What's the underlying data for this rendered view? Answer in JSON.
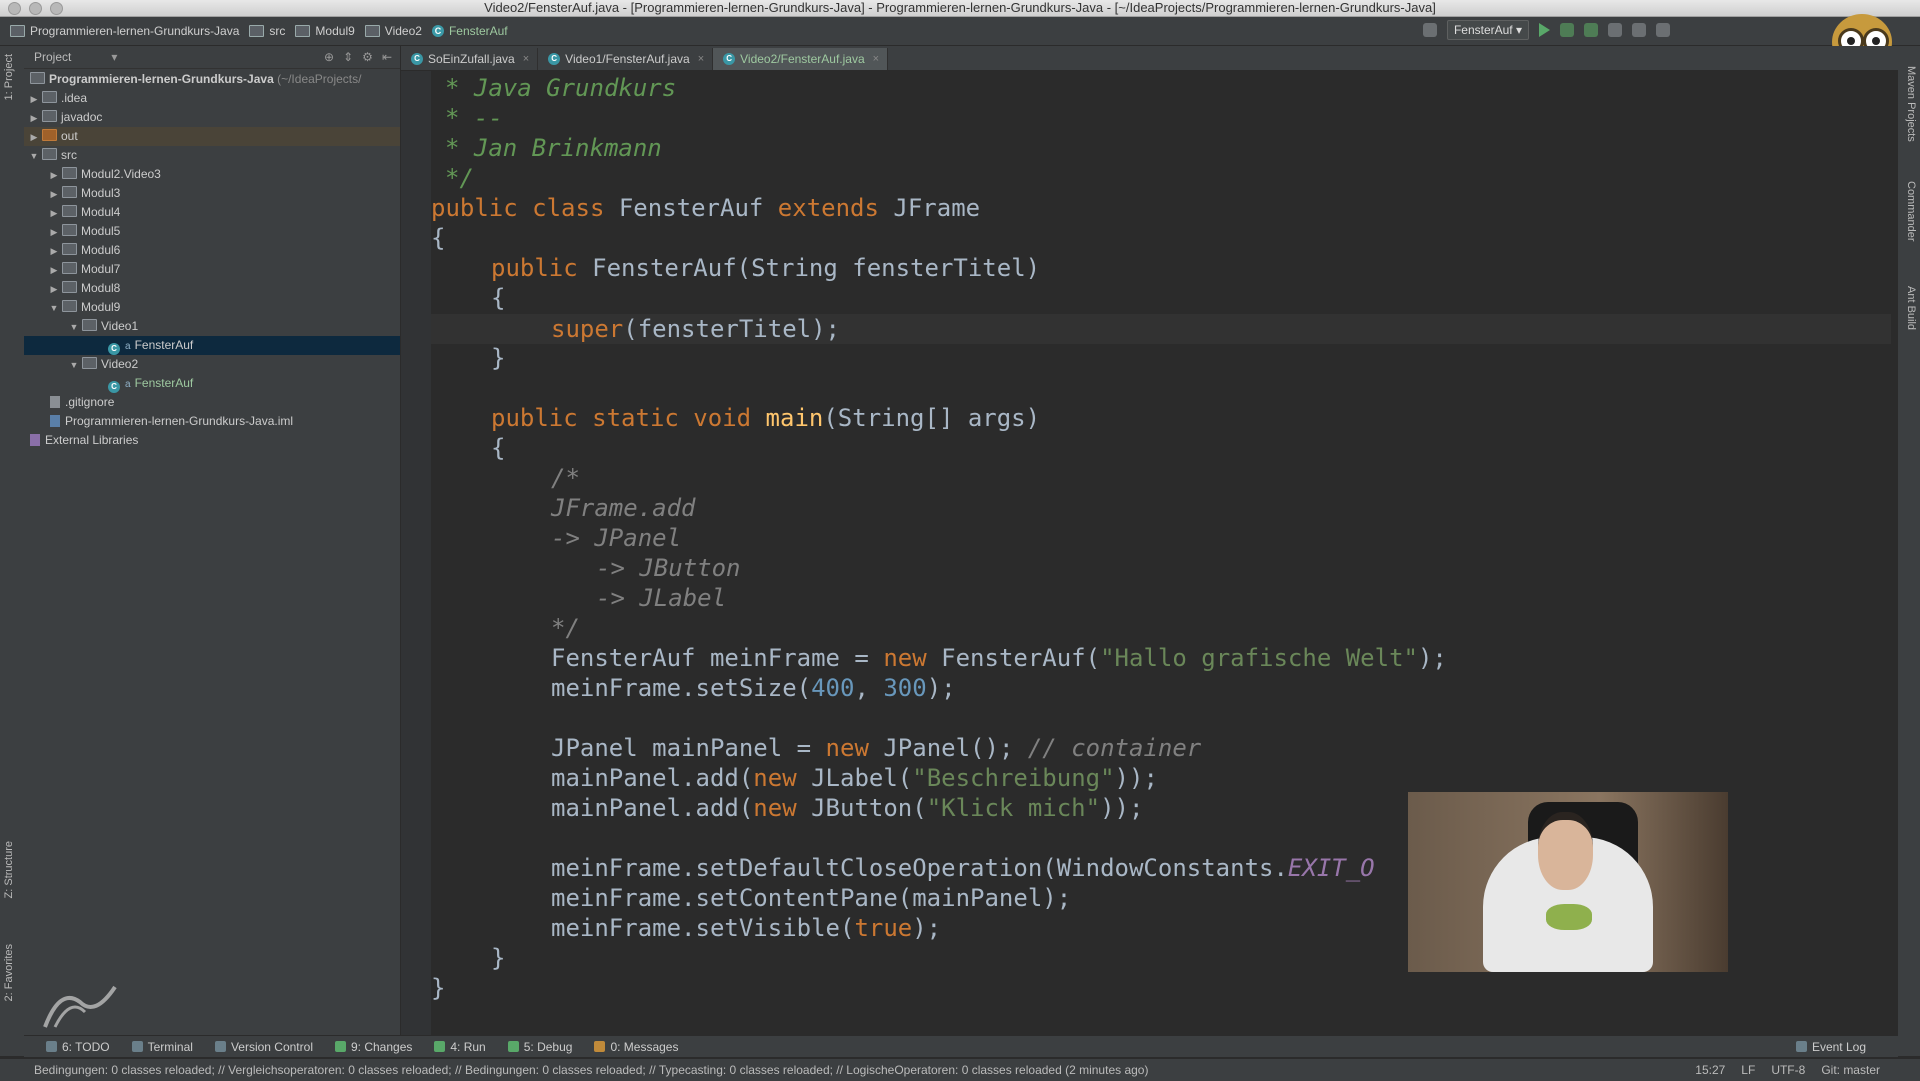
{
  "window": {
    "title": "Video2/FensterAuf.java - [Programmieren-lernen-Grundkurs-Java] - Programmieren-lernen-Grundkurs-Java - [~/IdeaProjects/Programmieren-lernen-Grundkurs-Java]"
  },
  "navbar": {
    "crumbs": [
      "Programmieren-lernen-Grundkurs-Java",
      "src",
      "Modul9",
      "Video2",
      "FensterAuf"
    ],
    "run_config": "FensterAuf"
  },
  "left_strip": {
    "tab1": "1: Project",
    "tab2": "Z: Structure",
    "tab3": "2: Favorites"
  },
  "right_strip": {
    "tab1": "Maven Projects",
    "tab2": "Commander",
    "tab3": "Ant Build"
  },
  "project_panel": {
    "header": "Project",
    "root": "Programmieren-lernen-Grundkurs-Java",
    "root_path": "(~/IdeaProjects/",
    "items": [
      {
        "label": ".idea"
      },
      {
        "label": "javadoc"
      },
      {
        "label": "out"
      },
      {
        "label": "src"
      },
      {
        "label": "Modul2.Video3"
      },
      {
        "label": "Modul3"
      },
      {
        "label": "Modul4"
      },
      {
        "label": "Modul5"
      },
      {
        "label": "Modul6"
      },
      {
        "label": "Modul7"
      },
      {
        "label": "Modul8"
      },
      {
        "label": "Modul9"
      },
      {
        "label": "Video1"
      },
      {
        "label": "FensterAuf"
      },
      {
        "label": "Video2"
      },
      {
        "label": "FensterAuf"
      },
      {
        "label": ".gitignore"
      },
      {
        "label": "Programmieren-lernen-Grundkurs-Java.iml"
      },
      {
        "label": "External Libraries"
      }
    ]
  },
  "tabs": [
    {
      "label": "SoEinZufall.java"
    },
    {
      "label": "Video1/FensterAuf.java"
    },
    {
      "label": "Video2/FensterAuf.java"
    }
  ],
  "code": {
    "l1": "* Java Grundkurs",
    "l2": "* --",
    "l3": "* Jan Brinkmann",
    "l4": "*/",
    "l5a": "public class ",
    "l5b": "FensterAuf ",
    "l5c": "extends ",
    "l5d": "JFrame",
    "l6": "{",
    "l7a": "public ",
    "l7b": "FensterAuf(String ",
    "l7c": "fensterTitel",
    "l7d": ")",
    "l8": "{",
    "l9a": "super",
    "l9b": "(fensterTitel);",
    "l10": "}",
    "l11a": "public static void ",
    "l11b": "main",
    "l11c": "(String[] args)",
    "l12": "{",
    "l13": "/*",
    "l14": "JFrame.add",
    "l15": "-> JPanel",
    "l16": "-> JButton",
    "l17": "-> JLabel",
    "l18": "*/",
    "l19a": "FensterAuf meinFrame = ",
    "l19b": "new ",
    "l19c": "FensterAuf(",
    "l19d": "\"Hallo grafische Welt\"",
    "l19e": ");",
    "l20a": "meinFrame.setSize(",
    "l20b": "400",
    "l20c": ", ",
    "l20d": "300",
    "l20e": ");",
    "l21a": "JPanel mainPanel = ",
    "l21b": "new ",
    "l21c": "JPanel()",
    "l21d": "; ",
    "l21e": "// container",
    "l22a": "mainPanel.add(",
    "l22b": "new ",
    "l22c": "JLabel(",
    "l22d": "\"Beschreibung\"",
    "l22e": "));",
    "l23a": "mainPanel.add(",
    "l23b": "new ",
    "l23c": "JButton(",
    "l23d": "\"Klick mich\"",
    "l23e": "));",
    "l24a": "meinFrame.setDefaultCloseOperation(WindowConstants.",
    "l24b": "EXIT_O",
    "l25": "meinFrame.setContentPane(mainPanel);",
    "l26a": "meinFrame.setVisible(",
    "l26b": "true",
    "l26c": ");",
    "l27": "}",
    "l28": "}"
  },
  "bottom_tools": {
    "todo": "6: TODO",
    "terminal": "Terminal",
    "vcs": "Version Control",
    "changes": "9: Changes",
    "run": "4: Run",
    "debug": "5: Debug",
    "messages": "0: Messages",
    "event_log": "Event Log"
  },
  "status": {
    "message": "Bedingungen: 0 classes reloaded; // Vergleichsoperatoren: 0 classes reloaded; // Bedingungen: 0 classes reloaded; // Typecasting: 0 classes reloaded; // LogischeOperatoren: 0 classes reloaded (2 minutes ago)",
    "position": "15:27",
    "line_sep": "LF",
    "encoding": "UTF-8",
    "git": "Git: master"
  }
}
